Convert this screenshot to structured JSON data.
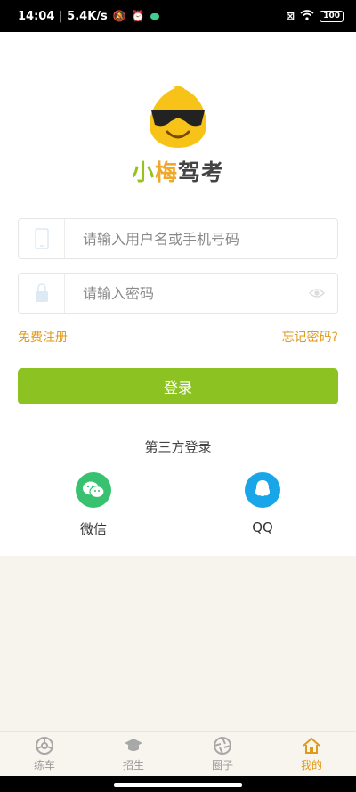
{
  "status_bar": {
    "time_speed": "14:04 | 5.4K/s",
    "battery": "100"
  },
  "logo": {
    "text_part1": "小",
    "text_part2": "梅",
    "text_part3": "驾考"
  },
  "login": {
    "username_placeholder": "请输入用户名或手机号码",
    "password_placeholder": "请输入密码",
    "register_link": "免费注册",
    "forgot_link": "忘记密码?",
    "login_button": "登录"
  },
  "third_party": {
    "title": "第三方登录",
    "options": [
      {
        "label": "微信",
        "icon": "wechat-icon"
      },
      {
        "label": "QQ",
        "icon": "qq-icon"
      }
    ]
  },
  "tabbar": {
    "items": [
      {
        "label": "练车",
        "icon": "steering-wheel-icon",
        "active": false
      },
      {
        "label": "招生",
        "icon": "graduation-cap-icon",
        "active": false
      },
      {
        "label": "圈子",
        "icon": "aperture-icon",
        "active": false
      },
      {
        "label": "我的",
        "icon": "home-icon",
        "active": true
      }
    ]
  },
  "colors": {
    "accent_green": "#8cc222",
    "accent_orange": "#e19a1a",
    "wechat_green": "#38c26f",
    "qq_blue": "#18a6e8"
  }
}
